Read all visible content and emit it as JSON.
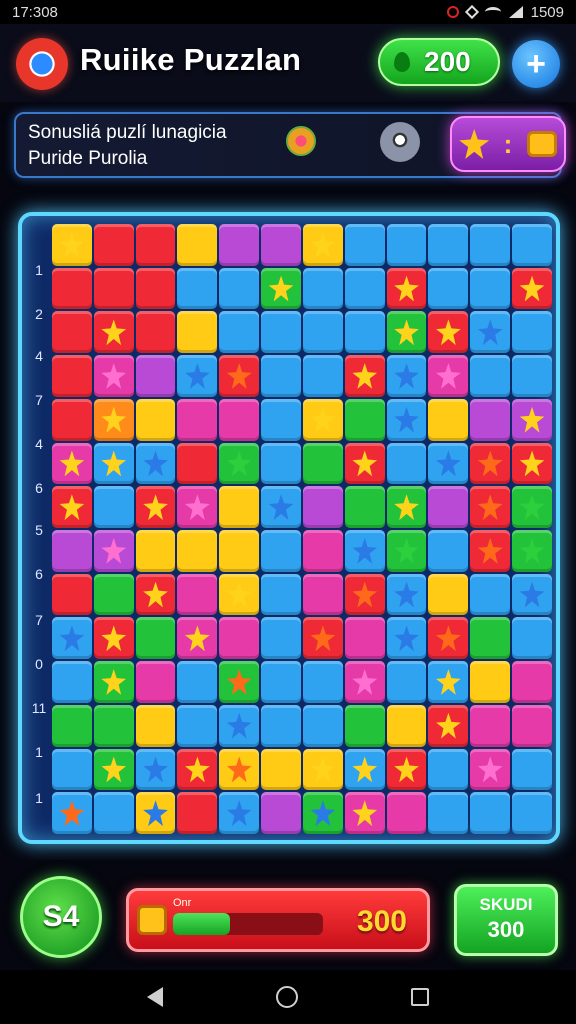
{
  "status_bar": {
    "time": "17:308",
    "right_text": "1509"
  },
  "header": {
    "title": "Ruiike Puzzlan",
    "coins": "200",
    "add_label": "+"
  },
  "info_panel": {
    "line1": "Sonusliá puzlí lunagicia",
    "line2": "Puride Purolia"
  },
  "board": {
    "row_numbers": [
      "1",
      "2",
      "4",
      "7",
      "4",
      "6",
      "5",
      "6",
      "7",
      "0",
      "11",
      "1",
      "1"
    ],
    "colors": {
      "b": "#2fa3f0",
      "r": "#ef2935",
      "y": "#ffcb14",
      "m": "#e63aa8",
      "g": "#22c23a",
      "p": "#b94ad6",
      "o": "#ff8c1a"
    },
    "rows": [
      [
        "y*y",
        "r",
        "r",
        "y",
        "p",
        "p",
        "y*y",
        "b",
        "b",
        "b",
        "b",
        "b"
      ],
      [
        "r",
        "r",
        "r",
        "b",
        "b",
        "g*y",
        "b",
        "b",
        "r*y",
        "b",
        "b",
        "r*y"
      ],
      [
        "r",
        "r*y",
        "r",
        "y",
        "b",
        "b",
        "b",
        "b",
        "g*y",
        "r*y",
        "b*b",
        "b"
      ],
      [
        "r",
        "m*m",
        "p",
        "b*b",
        "r*o",
        "b",
        "b",
        "r*y",
        "b*b",
        "m*m",
        "b",
        "b"
      ],
      [
        "r",
        "o*y",
        "y",
        "m",
        "m",
        "b",
        "y*y",
        "g",
        "b*b",
        "y",
        "p",
        "p*y"
      ],
      [
        "m*y",
        "b*y",
        "b*b",
        "r",
        "g*g",
        "b",
        "g",
        "r*y",
        "b",
        "b*b",
        "r*o",
        "r*y"
      ],
      [
        "r*y",
        "b",
        "r*y",
        "m*m",
        "y",
        "b*b",
        "p",
        "g",
        "g*y",
        "p",
        "r*o",
        "g*g"
      ],
      [
        "p",
        "p*m",
        "y",
        "y",
        "y",
        "b",
        "m",
        "b*b",
        "g*g",
        "b",
        "r*o",
        "g*g"
      ],
      [
        "r",
        "g",
        "r*y",
        "m",
        "y*y",
        "b",
        "m",
        "r*o",
        "b*b",
        "y",
        "b",
        "b*b"
      ],
      [
        "b*b",
        "r*y",
        "g",
        "m*y",
        "m",
        "b",
        "r*o",
        "m",
        "b*b",
        "r*o",
        "g",
        "b"
      ],
      [
        "b",
        "g*y",
        "m",
        "b",
        "g*o",
        "b",
        "b",
        "m*m",
        "b",
        "b*y",
        "y",
        "m"
      ],
      [
        "g",
        "g",
        "y",
        "b",
        "b*b",
        "b",
        "b",
        "g",
        "y",
        "r*y",
        "m",
        "m"
      ],
      [
        "b",
        "g*y",
        "b*b",
        "r*y",
        "y*o",
        "y",
        "y*y",
        "b*y",
        "r*y",
        "b",
        "m*m",
        "b"
      ],
      [
        "b*o",
        "b",
        "y*b",
        "r",
        "b*b",
        "p",
        "g*b",
        "m*y",
        "m",
        "b",
        "b",
        "b"
      ]
    ]
  },
  "bottom": {
    "moves": "S4",
    "score_label": "Onr",
    "progress": 0.38,
    "score": "300",
    "skudi_label": "SKUDI",
    "skudi_value": "300"
  }
}
